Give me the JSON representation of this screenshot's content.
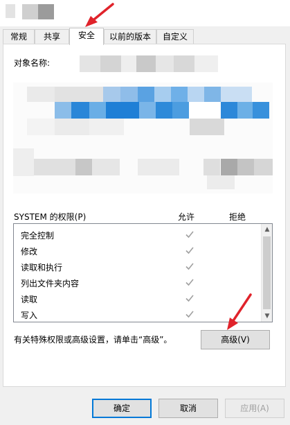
{
  "tabs": [
    {
      "label": "常规"
    },
    {
      "label": "共享"
    },
    {
      "label": "安全"
    },
    {
      "label": "以前的版本"
    },
    {
      "label": "自定义"
    }
  ],
  "object_name_label": "对象名称:",
  "permissions": {
    "header": "SYSTEM 的权限(P)",
    "allow_header": "允许",
    "deny_header": "拒绝",
    "rows": [
      {
        "name": "完全控制"
      },
      {
        "name": "修改"
      },
      {
        "name": "读取和执行"
      },
      {
        "name": "列出文件夹内容"
      },
      {
        "name": "读取"
      },
      {
        "name": "写入"
      }
    ]
  },
  "advanced_note": "有关特殊权限或高级设置，请单击“高级”。",
  "advanced_button": "高级(V)",
  "buttons": {
    "ok": "确定",
    "cancel": "取消",
    "apply": "应用(A)"
  },
  "colors": {
    "accent": "#0078d7",
    "arrow": "#e0232b",
    "check": "#a0a0a0"
  }
}
